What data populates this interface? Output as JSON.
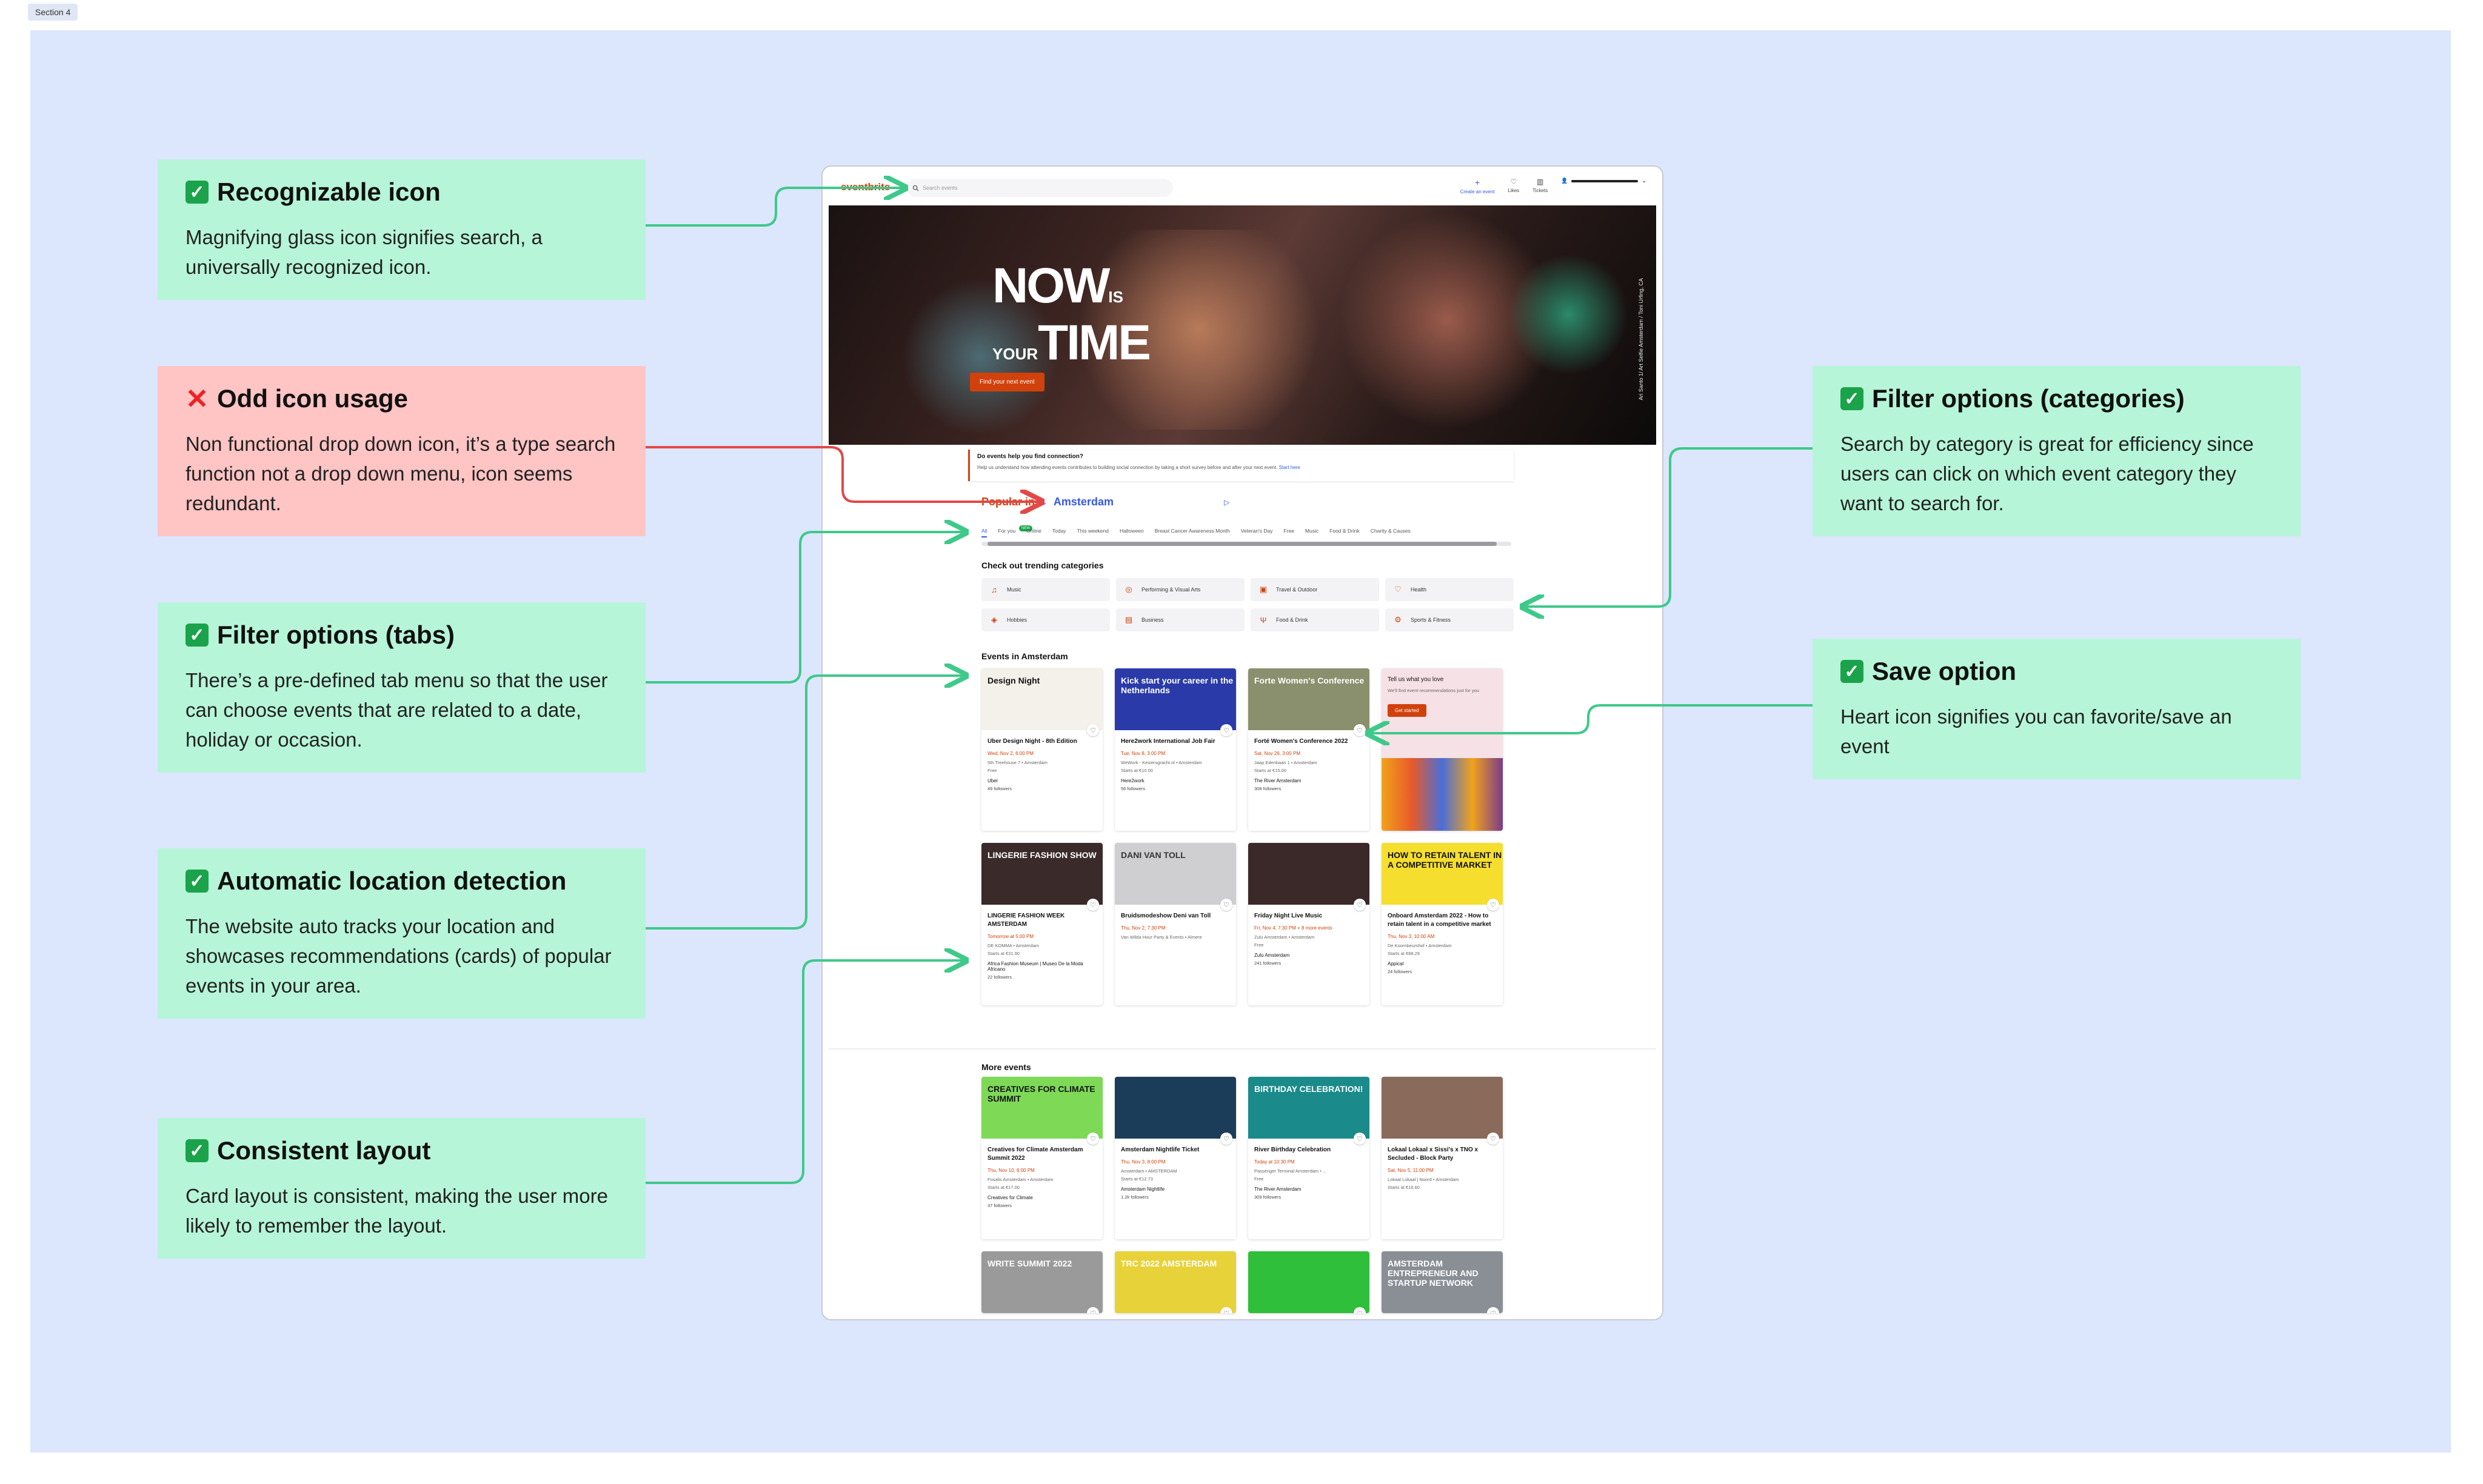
{
  "section_tag": "Section 4",
  "annotations": [
    {
      "kind": "good",
      "title": "Recognizable icon",
      "body": "Magnifying glass icon signifies search, a universally recognized icon."
    },
    {
      "kind": "bad",
      "title": "Odd icon usage",
      "body": "Non functional drop down icon, it’s a type search function not a drop down menu, icon seems redundant."
    },
    {
      "kind": "good",
      "title": "Filter options (tabs)",
      "body": "There’s a pre-defined tab menu so that the user can choose events that are related to a date, holiday or occasion."
    },
    {
      "kind": "good",
      "title": "Automatic location detection",
      "body": "The website auto tracks your location and showcases recommendations (cards) of popular events in your area."
    },
    {
      "kind": "good",
      "title": "Consistent layout",
      "body": "Card layout is consistent, making the user more likely to remember the layout."
    },
    {
      "kind": "good",
      "title": "Filter options (categories)",
      "body": "Search by category is great for efficiency since users can click on which event category they want to search for."
    },
    {
      "kind": "good",
      "title": "Save option",
      "body": "Heart icon signifies you can favorite/save an event"
    }
  ],
  "site": {
    "logo": "eventbrite",
    "search_placeholder": "Search events",
    "nav": {
      "create": "Create an event",
      "likes": "Likes",
      "tickets": "Tickets"
    },
    "hero": {
      "line1": "NOW",
      "is": "IS",
      "line2a": "YOUR",
      "line2b": "TIME",
      "button": "Find your next event",
      "side_text": "Ari Santo 1/ Art Selfie Amsterdam / Toni Urfing, CA"
    },
    "survey": {
      "title": "Do events help you find connection?",
      "text": "Help us understand how attending events contributes to building social connection by taking a short survey before and after your next event.",
      "link": "Start here"
    },
    "popular": {
      "label": "Popular in",
      "city": "Amsterdam"
    },
    "tabs": [
      "All",
      "For you",
      "Online",
      "Today",
      "This weekend",
      "Halloween",
      "Breast Cancer Awareness Month",
      "Veteran's Day",
      "Free",
      "Music",
      "Food & Drink",
      "Charity & Causes"
    ],
    "foryou_badge": "NEW",
    "trending_title": "Check out trending categories",
    "categories": [
      {
        "icon": "music-icon",
        "glyph": "♫",
        "label": "Music"
      },
      {
        "icon": "art-icon",
        "glyph": "◎",
        "label": "Performing & Visual Arts"
      },
      {
        "icon": "travel-icon",
        "glyph": "▣",
        "label": "Travel & Outdoor"
      },
      {
        "icon": "health-icon",
        "glyph": "♡",
        "label": "Health"
      },
      {
        "icon": "hobbies-icon",
        "glyph": "◈",
        "label": "Hobbies"
      },
      {
        "icon": "business-icon",
        "glyph": "▤",
        "label": "Business"
      },
      {
        "icon": "food-icon",
        "glyph": "Ψ",
        "label": "Food & Drink"
      },
      {
        "icon": "sports-icon",
        "glyph": "⚙",
        "label": "Sports & Fitness"
      }
    ],
    "events_title": "Events in Amsterdam",
    "events": [
      {
        "title": "Uber Design Night - 8th Edition",
        "date": "Wed, Nov 2, 6:00 PM",
        "loc": "5th Treehouse 7 • Amsterdam",
        "price": "Free",
        "org": "Uber",
        "fol": "49 followers",
        "color": "#f4f1ea",
        "img_text": "Design Night",
        "text_color": "#111"
      },
      {
        "title": "Here2work International Job Fair",
        "date": "Tue, Nov 8, 3:00 PM",
        "loc": "WeWork - Keizersgracht.nl • Amsterdam",
        "price": "Starts at €10.00",
        "org": "Here2work",
        "fol": "56 followers",
        "color": "#2a3aa8",
        "img_text": "Kick start your career in the Netherlands",
        "text_color": "#fff"
      },
      {
        "title": "Forté Women's Conference 2022",
        "date": "Sat, Nov 26, 3:00 PM",
        "loc": "Jaap Edenbaan 1 • Amsterdam",
        "price": "Starts at €15.00",
        "org": "The River Amsterdam",
        "fol": "308 followers",
        "color": "#8a8f6d",
        "img_text": "Forte Women's Conference",
        "text_color": "#fff"
      },
      {
        "title": "Tell us what you love",
        "date": "",
        "loc": "",
        "price": "",
        "org": "",
        "fol": "",
        "color": "#f5e1e6",
        "img_text": "",
        "text_color": "#333",
        "promo": true,
        "promo_button": "Get started",
        "promo_sub": "We'll find event recommendations just for you"
      },
      {
        "title": "LINGERIE FASHION WEEK AMSTERDAM",
        "date": "Tomorrow at 5:00 PM",
        "loc": "DE KOMMA • Amsterdam",
        "price": "Starts at €31.90",
        "org": "Africa Fashion Museum | Museo De la Moda Africano",
        "fol": "22 followers",
        "color": "#3a2a2a",
        "img_text": "LINGERIE FASHION SHOW",
        "text_color": "#fff"
      },
      {
        "title": "Bruidsmodeshow Deni van Toll",
        "date": "Thu, Nov 2, 7:30 PM",
        "loc": "Van Wilda Hour Party & Events • Almere",
        "price": "",
        "org": "",
        "fol": "",
        "color": "#cfcfd2",
        "img_text": "DANI VAN TOLL",
        "text_color": "#333"
      },
      {
        "title": "Friday Night Live Music",
        "date": "Fri, Nov 4, 7:30 PM + 8 more events",
        "loc": "Zulu Amsterdam • Amsterdam",
        "price": "Free",
        "org": "Zulu Amsterdam",
        "fol": "241 followers",
        "color": "#3b2828",
        "img_text": "",
        "text_color": "#fff"
      },
      {
        "title": "Onboard Amsterdam 2022 - How to retain talent in a competitive market",
        "date": "Thu, Nov 3, 10:00 AM",
        "loc": "De Koornbeurshof • Amsterdam",
        "price": "Starts at €88.29",
        "org": "Appical",
        "fol": "24 followers",
        "color": "#f5de2e",
        "img_text": "HOW TO RETAIN TALENT IN A COMPETITIVE MARKET",
        "text_color": "#111"
      }
    ],
    "more_title": "More events",
    "more_events": [
      {
        "title": "Creatives for Climate Amsterdam Summit 2022",
        "date": "Thu, Nov 10, 6:00 PM",
        "loc": "Fosalis Amsterdam • Amsterdam",
        "price": "Starts at €17.00",
        "org": "Creatives for Climate",
        "fol": "37 followers",
        "color": "#7ed957",
        "img_text": "CREATIVES FOR CLIMATE SUMMIT",
        "text_color": "#111"
      },
      {
        "title": "Amsterdam Nightlife Ticket",
        "date": "Thu, Nov 3, 8:00 PM",
        "loc": "Amsterdam • AMSTERDAM",
        "price": "Starts at €12.73",
        "org": "Amsterdam Nightlife",
        "fol": "1.2k followers",
        "color": "#1c3d5a",
        "img_text": "",
        "text_color": "#fff"
      },
      {
        "title": "River Birthday Celebration",
        "date": "Today at 10:30 PM",
        "loc": "Passenger Terminal Amsterdam • ...",
        "price": "Free",
        "org": "The River Amsterdam",
        "fol": "309 followers",
        "color": "#1a8a8a",
        "img_text": "BIRTHDAY CELEBRATION!",
        "text_color": "#fff"
      },
      {
        "title": "Lokaal Lokaal x Sissi's x TNO x Secluded - Block Party",
        "date": "Sat, Nov 5, 11:00 PM",
        "loc": "Lokaal Lokaal | Noord • Amsterdam",
        "price": "Starts at €16.60",
        "org": "",
        "fol": "",
        "color": "#8a6a5a",
        "img_text": "",
        "text_color": "#fff"
      },
      {
        "title": "",
        "color": "#9a9a9a",
        "img_text": "WRITE SUMMIT 2022",
        "text_color": "#fff"
      },
      {
        "title": "",
        "color": "#e8d23a",
        "img_text": "TRC 2022 AMSTERDAM",
        "text_color": "#fff"
      },
      {
        "title": "",
        "color": "#2fbf3a",
        "img_text": "",
        "text_color": "#111"
      },
      {
        "title": "",
        "color": "#8a8f96",
        "img_text": "AMSTERDAM ENTREPRENEUR AND STARTUP NETWORK",
        "text_color": "#fff"
      }
    ]
  },
  "colors": {
    "canvas": "#dce6fc",
    "good": "#b6f5d8",
    "bad": "#ffc4c4",
    "arrow_good": "#3ec98a",
    "arrow_bad": "#e34848",
    "brand": "#d1410c",
    "link": "#3659e3"
  }
}
